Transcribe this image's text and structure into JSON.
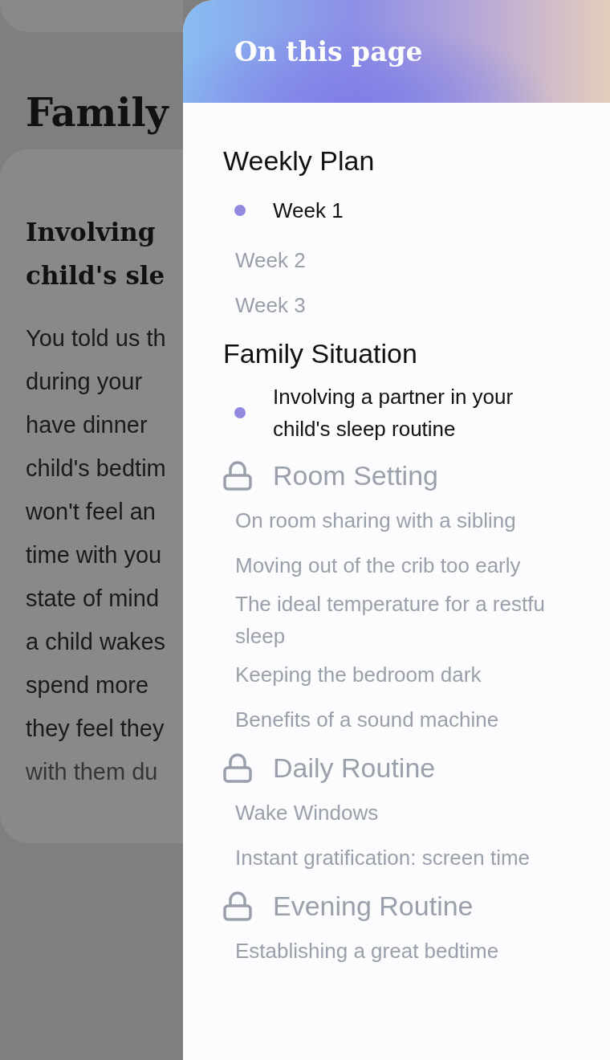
{
  "page": {
    "title": "Family",
    "card": {
      "heading": [
        "Involving",
        "child's sle"
      ],
      "paragraph": [
        "You told us th",
        "during your",
        "have dinner",
        "child's bedtim",
        "won't feel an",
        "time with you",
        "state of mind",
        "a child wakes",
        "spend more",
        "they feel they",
        "with them du"
      ]
    }
  },
  "drawer": {
    "title": "On this page",
    "sections": [
      {
        "title": "Weekly Plan",
        "locked": false,
        "items": [
          {
            "label": "Week 1",
            "selected": true
          },
          {
            "label": "Week 2",
            "selected": false
          },
          {
            "label": "Week 3",
            "selected": false
          }
        ]
      },
      {
        "title": "Family Situation",
        "locked": false,
        "items": [
          {
            "label": "Involving a partner in your\nchild's sleep routine",
            "selected": true
          }
        ]
      },
      {
        "title": "Room Setting",
        "locked": true,
        "items": [
          {
            "label": "On room sharing with a sibling",
            "selected": false
          },
          {
            "label": "Moving out of the crib too early",
            "selected": false
          },
          {
            "label": "The ideal temperature for a restfu\nsleep",
            "selected": false
          },
          {
            "label": "Keeping the bedroom dark",
            "selected": false
          },
          {
            "label": "Benefits of a sound machine",
            "selected": false
          }
        ]
      },
      {
        "title": "Daily Routine",
        "locked": true,
        "items": [
          {
            "label": "Wake Windows",
            "selected": false
          },
          {
            "label": "Instant gratification: screen time",
            "selected": false
          }
        ]
      },
      {
        "title": "Evening Routine",
        "locked": true,
        "items": [
          {
            "label": "Establishing a great bedtime",
            "selected": false
          }
        ]
      }
    ]
  }
}
